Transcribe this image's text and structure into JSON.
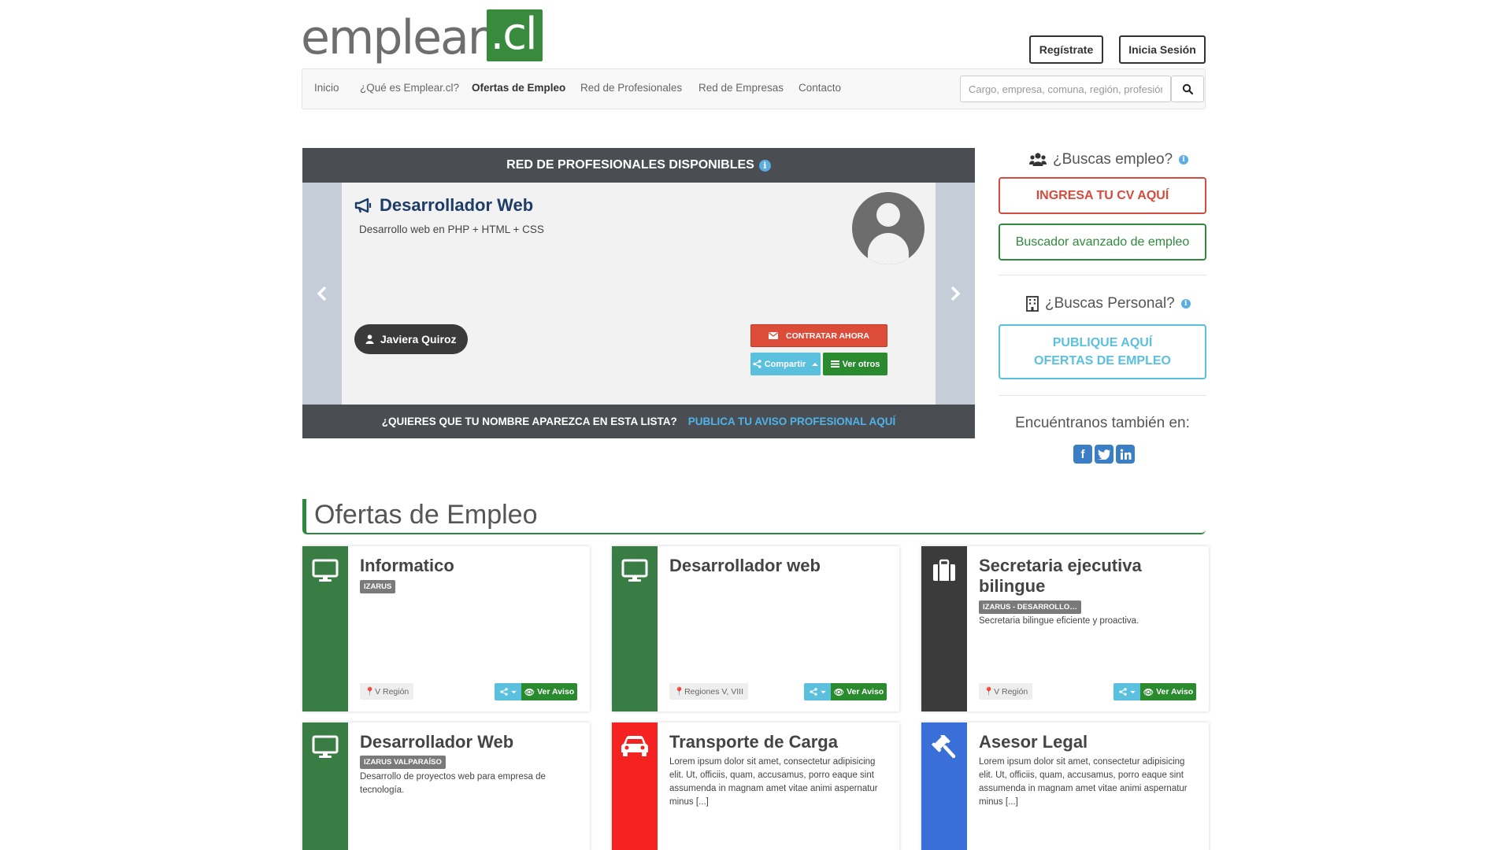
{
  "brand": {
    "logo_main": "emplear",
    "logo_box": ".cl"
  },
  "header": {
    "register_label": "Regístrate",
    "login_label": "Inicia Sesión"
  },
  "nav": {
    "items": [
      {
        "label": "Inicio"
      },
      {
        "label": "¿Qué es Emplear.cl?"
      },
      {
        "label": "Ofertas de Empleo",
        "active": true
      },
      {
        "label": "Red de Profesionales"
      },
      {
        "label": "Red de Empresas"
      },
      {
        "label": "Contacto"
      }
    ],
    "search_placeholder": "Cargo, empresa, comuna, región, profesión"
  },
  "carousel": {
    "heading": "RED DE PROFESIONALES DISPONIBLES",
    "title": "Desarrollador Web",
    "description": "Desarrollo web en PHP + HTML + CSS",
    "person": "Javiera Quiroz",
    "contract_label": "CONTRATAR AHORA",
    "share_label": "Compartir",
    "others_label": "Ver otros",
    "footer_question": "¿QUIERES QUE TU NOMBRE APAREZCA EN ESTA LISTA?",
    "footer_link": "PUBLICA TU AVISO PROFESIONAL AQUÍ"
  },
  "sidebar": {
    "job_heading": "¿Buscas empleo?",
    "cv_button": "INGRESA TU CV AQUÍ",
    "advanced_button": "Buscador avanzado de empleo",
    "staff_heading": "¿Buscas Personal?",
    "publish_line1": "PUBLIQUE AQUÍ",
    "publish_line2": "OFERTAS DE EMPLEO",
    "find_us": "Encuéntranos también en:",
    "social": [
      "facebook-icon",
      "twitter-icon",
      "linkedin-icon"
    ]
  },
  "offers": {
    "title": "Ofertas de Empleo",
    "view_label": "Ver Aviso",
    "cards": [
      {
        "title": "Informatico",
        "badge": "IZARUS",
        "description": "",
        "region": "V Región",
        "color": "#3a7d44",
        "icon": "monitor-icon"
      },
      {
        "title": "Desarrollador web",
        "badge": "",
        "description": "",
        "region": "Regiones V, VIII",
        "color": "#3a7d44",
        "icon": "monitor-icon"
      },
      {
        "title": "Secretaria ejecutiva bilingue",
        "badge": "IZARUS - DESARROLLO Y...",
        "description": "Secretaria bilingue eficiente y proactiva.",
        "region": "V Región",
        "color": "#3b3b3b",
        "icon": "briefcase-icon"
      },
      {
        "title": "Desarrollador Web",
        "badge": "IZARUS VALPARAÍSO",
        "description": "Desarrollo de proyectos web para empresa de tecnología.",
        "region": "",
        "color": "#3a7d44",
        "icon": "monitor-icon"
      },
      {
        "title": "Transporte de Carga",
        "badge": "",
        "description": "Lorem ipsum dolor sit amet, consectetur adipisicing elit. Ut, officiis, quam, accusamus, porro eaque sint assumenda in magnam amet vitae animi aspernatur minus [...]",
        "region": "",
        "color": "#f52222",
        "icon": "car-icon"
      },
      {
        "title": "Asesor Legal",
        "badge": "",
        "description": "Lorem ipsum dolor sit amet, consectetur adipisicing elit. Ut, officiis, quam, accusamus, porro eaque sint assumenda in magnam amet vitae animi aspernatur minus [...]",
        "region": "",
        "color": "#3a6fd8",
        "icon": "gavel-icon"
      }
    ]
  }
}
